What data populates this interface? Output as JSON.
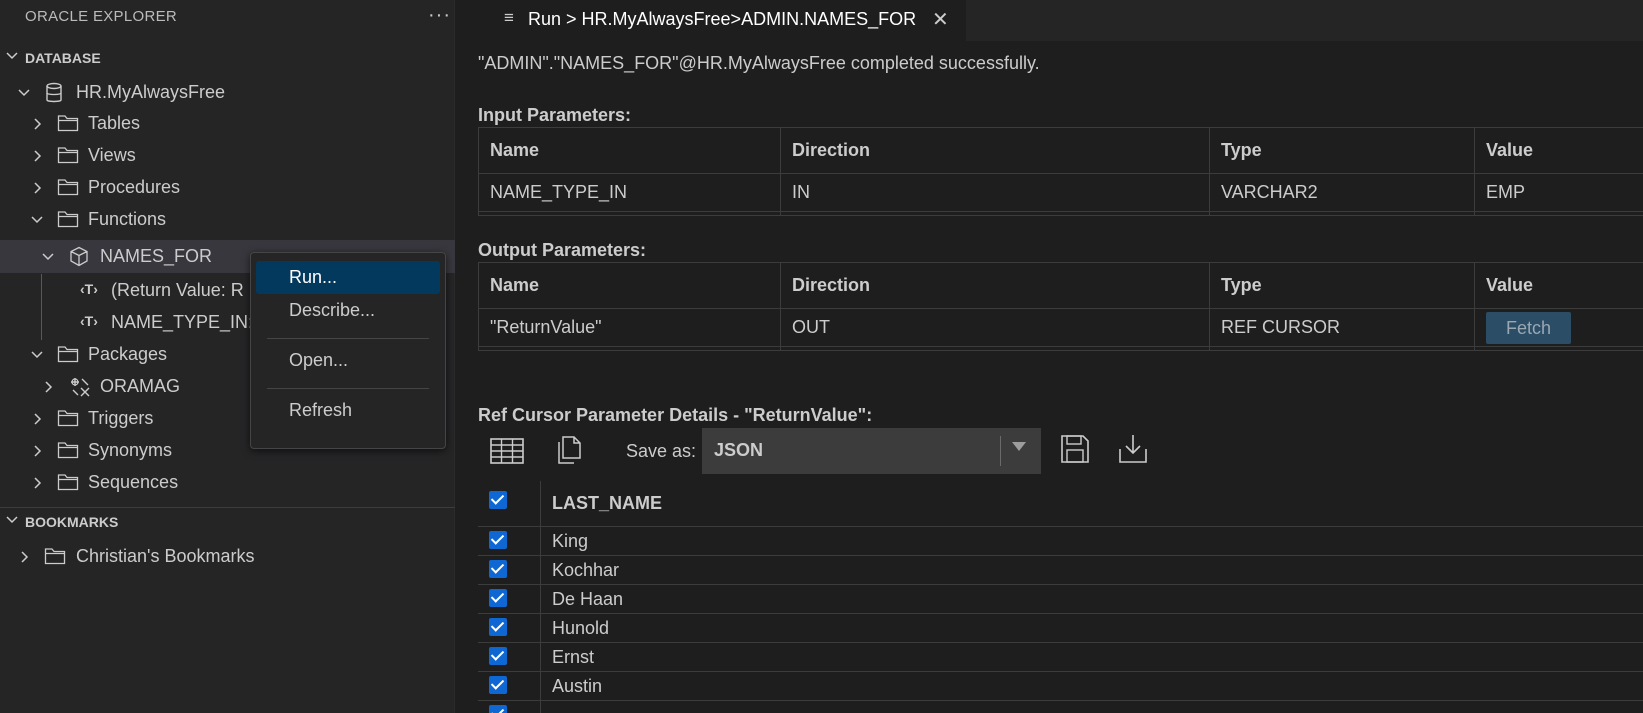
{
  "sidebar": {
    "title": "ORACLE EXPLORER",
    "more_label": "···",
    "database_section": "DATABASE",
    "bookmarks_section": "BOOKMARKS",
    "tree": [
      {
        "label": "HR.MyAlwaysFree",
        "icon": "database-icon"
      },
      {
        "label": "Tables",
        "icon": "folder-icon"
      },
      {
        "label": "Views",
        "icon": "folder-icon"
      },
      {
        "label": "Procedures",
        "icon": "folder-icon"
      },
      {
        "label": "Functions",
        "icon": "folder-icon"
      },
      {
        "label": "NAMES_FOR",
        "icon": "cube-icon"
      },
      {
        "label": "(Return Value: R",
        "icon": "type-icon"
      },
      {
        "label": "NAME_TYPE_IN:",
        "icon": "type-icon"
      },
      {
        "label": "Packages",
        "icon": "folder-icon"
      },
      {
        "label": "ORAMAG",
        "icon": "package-icon"
      },
      {
        "label": "Triggers",
        "icon": "folder-icon"
      },
      {
        "label": "Synonyms",
        "icon": "folder-icon"
      },
      {
        "label": "Sequences",
        "icon": "folder-icon"
      }
    ],
    "bookmarks": [
      {
        "label": "Christian's Bookmarks",
        "icon": "folder-icon"
      }
    ]
  },
  "context_menu": {
    "items": [
      "Run...",
      "Describe...",
      "Open...",
      "Refresh"
    ]
  },
  "tab": {
    "title": "Run > HR.MyAlwaysFree>ADMIN.NAMES_FOR",
    "close": "✕"
  },
  "main": {
    "message": "\"ADMIN\".\"NAMES_FOR\"@HR.MyAlwaysFree completed successfully.",
    "input_title": "Input Parameters:",
    "output_title": "Output Parameters:",
    "columns": [
      "Name",
      "Direction",
      "Type",
      "Value"
    ],
    "input_rows": [
      {
        "name": "NAME_TYPE_IN",
        "direction": "IN",
        "type": "VARCHAR2",
        "value": "EMP"
      }
    ],
    "output_rows": [
      {
        "name": "\"ReturnValue\"",
        "direction": "OUT",
        "type": "REF CURSOR",
        "value": "Fetch"
      }
    ],
    "refcursor_title": "Ref Cursor Parameter Details - \"ReturnValue\":",
    "save_as_label": "Save as:",
    "save_as_value": "JSON",
    "grid_header": "LAST_NAME",
    "grid_rows": [
      "King",
      "Kochhar",
      "De Haan",
      "Hunold",
      "Ernst",
      "Austin",
      ""
    ]
  },
  "colors": {
    "accent": "#0e67d2",
    "menu_active": "#04395e",
    "selected_row": "#37373d"
  }
}
